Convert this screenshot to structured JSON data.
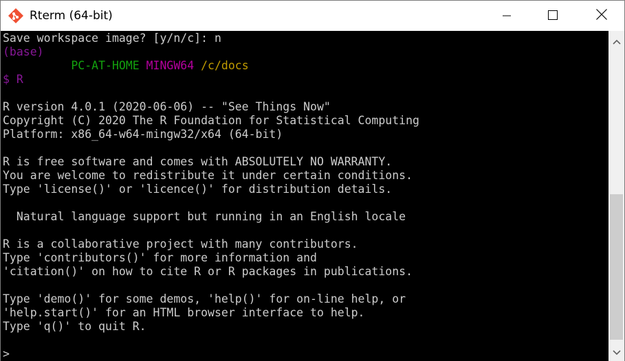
{
  "window": {
    "title": "Rterm (64-bit)"
  },
  "icons": {
    "app": "git-diamond-icon",
    "minimize": "minimize-icon",
    "maximize": "maximize-icon",
    "close": "close-icon",
    "scroll_up": "chevron-up-icon",
    "scroll_down": "chevron-down-icon"
  },
  "colors": {
    "console_background": "#000000",
    "console_text": "#cccccc",
    "conda_env": "#881798",
    "hostname": "#13a10e",
    "shell_name": "#b4009e",
    "cwd": "#c19c00"
  },
  "console": {
    "save_prompt": "Save workspace image? [y/n/c]: n",
    "conda_env": "(base)",
    "prompt_header": {
      "hostname": "PC-AT-HOME",
      "shell": "MINGW64",
      "cwd": "/c/docs"
    },
    "command_line": "$ R",
    "startup_lines": [
      "R version 4.0.1 (2020-06-06) -- \"See Things Now\"",
      "Copyright (C) 2020 The R Foundation for Statistical Computing",
      "Platform: x86_64-w64-mingw32/x64 (64-bit)",
      "R is free software and comes with ABSOLUTELY NO WARRANTY.",
      "You are welcome to redistribute it under certain conditions.",
      "Type 'license()' or 'licence()' for distribution details.",
      "  Natural language support but running in an English locale",
      "R is a collaborative project with many contributors.",
      "Type 'contributors()' for more information and",
      "'citation()' on how to cite R or R packages in publications.",
      "Type 'demo()' for some demos, 'help()' for on-line help, or",
      "'help.start()' for an HTML browser interface to help.",
      "Type 'q()' to quit R."
    ],
    "r_prompt": ">"
  }
}
